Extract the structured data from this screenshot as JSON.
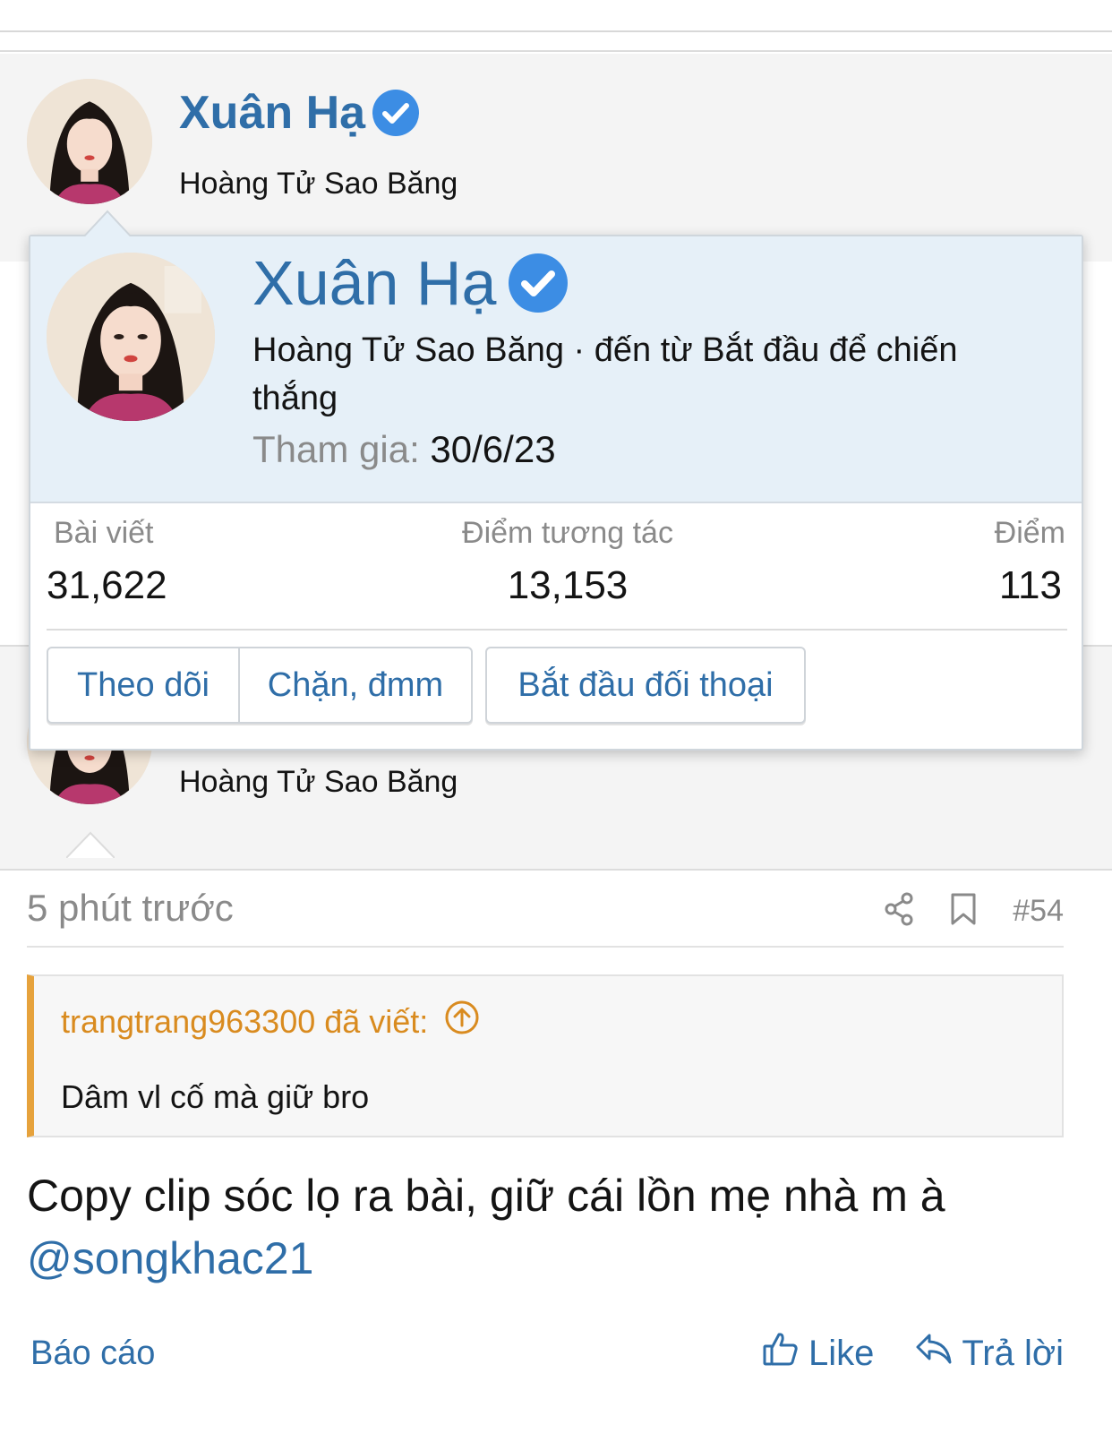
{
  "post_user": {
    "name": "Xuân Hạ",
    "title": "Hoàng Tử Sao Băng"
  },
  "popup": {
    "name": "Xuân Hạ",
    "subtitle": "Hoàng Tử Sao Băng · đến từ Bắt đầu để chiến thắng",
    "join_label": "Tham gia: ",
    "join_date": "30/6/23",
    "stats": [
      {
        "label": "Bài viết",
        "value": "31,622"
      },
      {
        "label": "Điểm tương tác",
        "value": "13,153"
      },
      {
        "label": "Điểm",
        "value": "113"
      }
    ],
    "buttons": {
      "follow": "Theo dõi",
      "block": "Chặn, đmm",
      "conversation": "Bắt đầu đối thoại"
    }
  },
  "post": {
    "user_title": "Hoàng Tử Sao Băng",
    "time": "5 phút trước",
    "number": "#54",
    "quote_author": "trangtrang963300 đã viết:",
    "quote_text": "Dâm vl cố mà giữ bro",
    "body_text": "Copy clip sóc lọ ra bài, giữ cái lồn mẹ nhà m à ",
    "mention": "@songkhac21",
    "report": "Báo cáo",
    "like": "Like",
    "reply": "Trả lời"
  },
  "colors": {
    "link": "#2f6ea8",
    "verified": "#3c8de4",
    "quote_accent": "#e6a23c",
    "popup_header": "#e6f0f8"
  },
  "icons": [
    "verified-icon",
    "share-icon",
    "bookmark-icon",
    "quote-jump-icon",
    "like-icon",
    "reply-icon"
  ]
}
